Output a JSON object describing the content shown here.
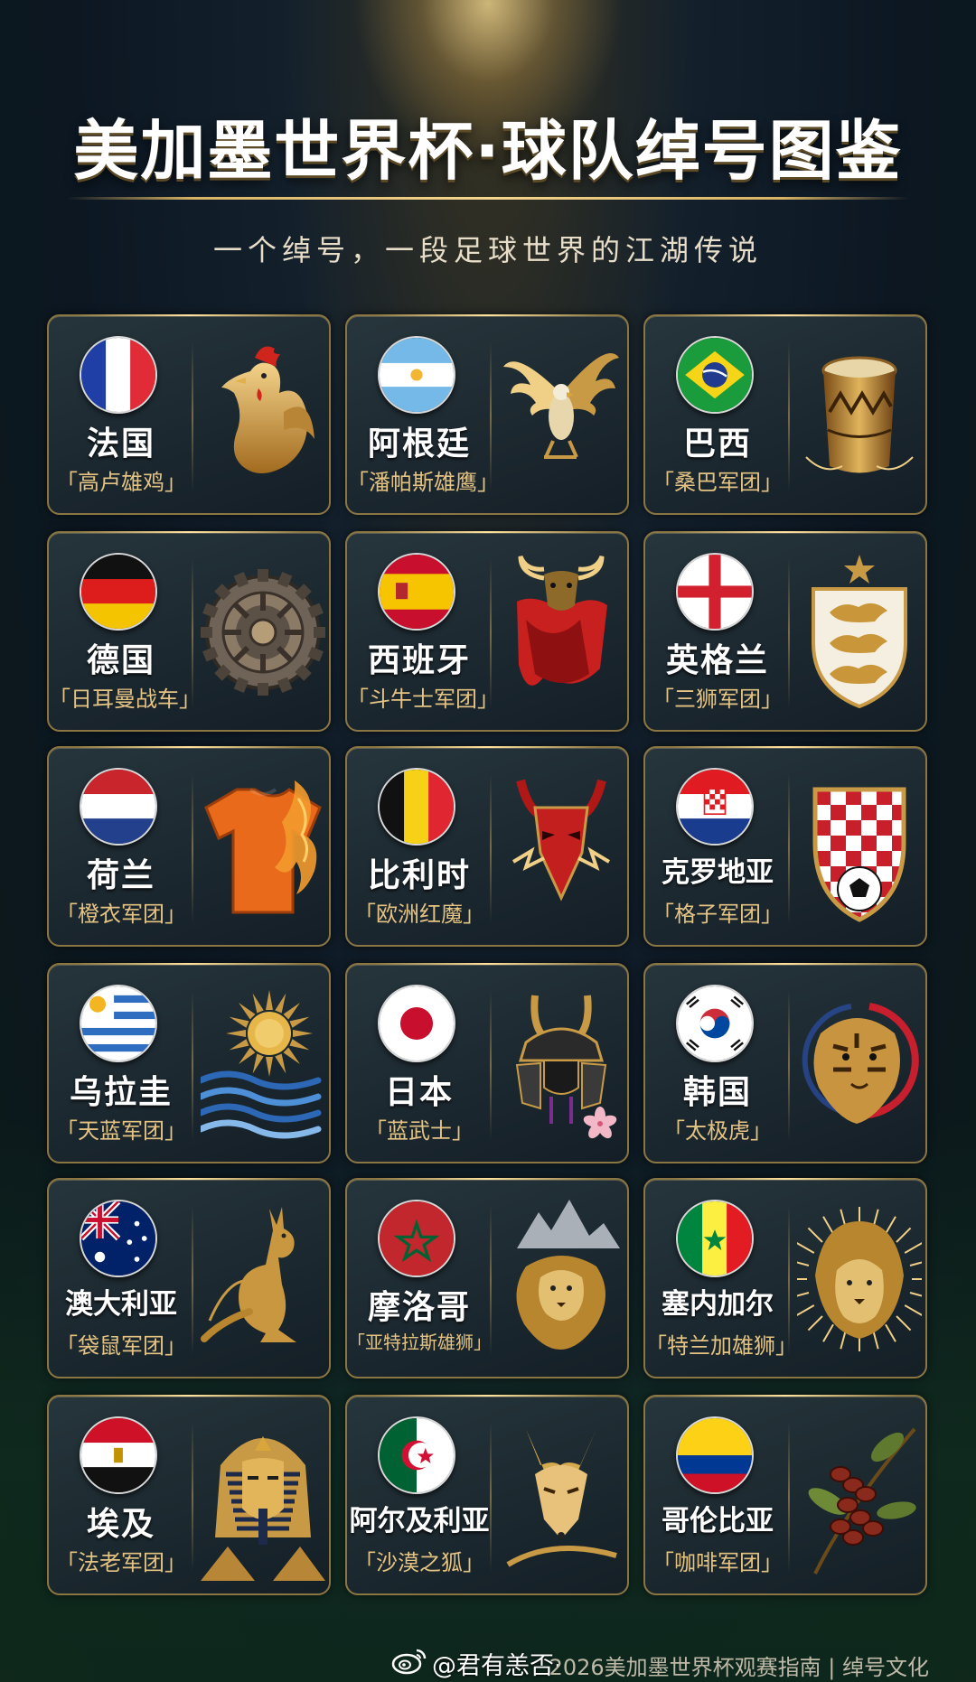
{
  "header": {
    "title": "美加墨世界杯·球队绰号图鉴",
    "subtitle": "一个绰号，一段足球世界的江湖传说"
  },
  "teams": [
    {
      "country": "法国",
      "nickname": "「高卢雄鸡」",
      "flag": "france-flag-icon",
      "emblem": "rooster-icon"
    },
    {
      "country": "阿根廷",
      "nickname": "「潘帕斯雄鹰」",
      "flag": "argentina-flag-icon",
      "emblem": "eagle-icon"
    },
    {
      "country": "巴西",
      "nickname": "「桑巴军团」",
      "flag": "brazil-flag-icon",
      "emblem": "samba-drum-icon"
    },
    {
      "country": "德国",
      "nickname": "「日耳曼战车」",
      "flag": "germany-flag-icon",
      "emblem": "gear-wheel-icon"
    },
    {
      "country": "西班牙",
      "nickname": "「斗牛士军团」",
      "flag": "spain-flag-icon",
      "emblem": "bull-cape-icon"
    },
    {
      "country": "英格兰",
      "nickname": "「三狮军团」",
      "flag": "england-flag-icon",
      "emblem": "three-lions-shield-icon"
    },
    {
      "country": "荷兰",
      "nickname": "「橙衣军团」",
      "flag": "netherlands-flag-icon",
      "emblem": "orange-jersey-icon"
    },
    {
      "country": "比利时",
      "nickname": "「欧洲红魔」",
      "flag": "belgium-flag-icon",
      "emblem": "red-devil-icon"
    },
    {
      "country": "克罗地亚",
      "nickname": "「格子军团」",
      "flag": "croatia-flag-icon",
      "emblem": "checkered-shield-icon"
    },
    {
      "country": "乌拉圭",
      "nickname": "「天蓝军团」",
      "flag": "uruguay-flag-icon",
      "emblem": "sun-waves-icon"
    },
    {
      "country": "日本",
      "nickname": "「蓝武士」",
      "flag": "japan-flag-icon",
      "emblem": "samurai-helmet-icon"
    },
    {
      "country": "韩国",
      "nickname": "「太极虎」",
      "flag": "korea-flag-icon",
      "emblem": "tiger-icon"
    },
    {
      "country": "澳大利亚",
      "nickname": "「袋鼠军团」",
      "flag": "australia-flag-icon",
      "emblem": "kangaroo-icon"
    },
    {
      "country": "摩洛哥",
      "nickname": "「亚特拉斯雄狮」",
      "flag": "morocco-flag-icon",
      "emblem": "atlas-lion-icon"
    },
    {
      "country": "塞内加尔",
      "nickname": "「特兰加雄狮」",
      "flag": "senegal-flag-icon",
      "emblem": "lion-icon"
    },
    {
      "country": "埃及",
      "nickname": "「法老军团」",
      "flag": "egypt-flag-icon",
      "emblem": "pharaoh-icon"
    },
    {
      "country": "阿尔及利亚",
      "nickname": "「沙漠之狐」",
      "flag": "algeria-flag-icon",
      "emblem": "desert-fox-icon"
    },
    {
      "country": "哥伦比亚",
      "nickname": "「咖啡军团」",
      "flag": "colombia-flag-icon",
      "emblem": "coffee-beans-icon"
    }
  ],
  "footer": {
    "handle": "@君有恙否·",
    "text": "2026美加墨世界杯观赛指南 | 绰号文化"
  },
  "colors": {
    "gold": "#d9b364",
    "card_border": "#8b7643",
    "nickname": "#e4c383"
  }
}
